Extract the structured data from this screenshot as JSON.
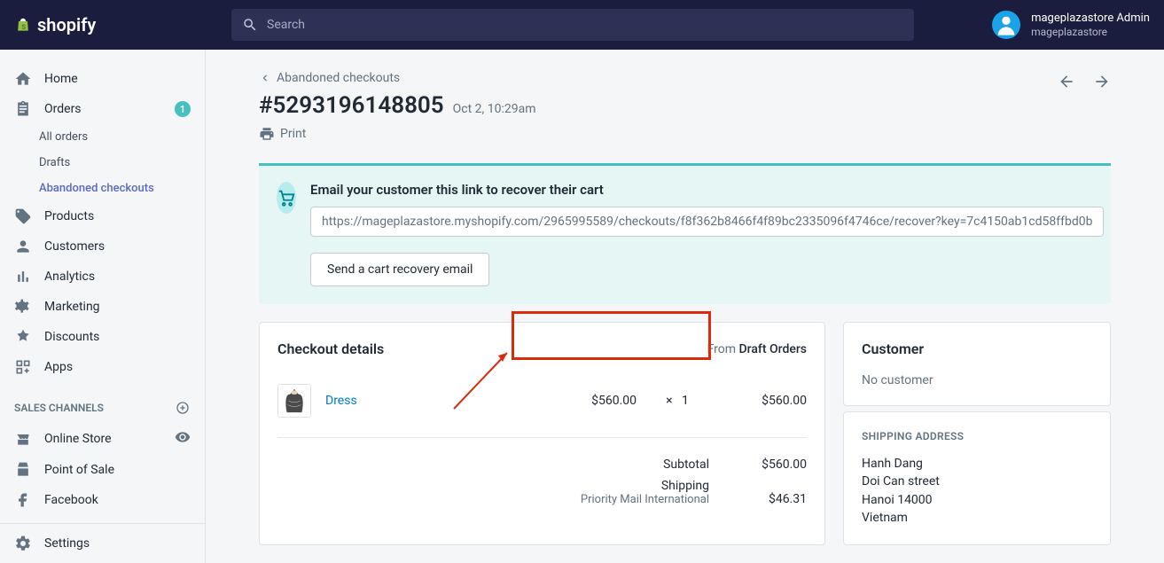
{
  "topbar": {
    "brand": "shopify",
    "search_placeholder": "Search",
    "user_name": "mageplazastore Admin",
    "store_name": "mageplazastore"
  },
  "sidebar": {
    "home": "Home",
    "orders": "Orders",
    "orders_badge": "1",
    "all_orders": "All orders",
    "drafts": "Drafts",
    "abandoned": "Abandoned checkouts",
    "products": "Products",
    "customers": "Customers",
    "analytics": "Analytics",
    "marketing": "Marketing",
    "discounts": "Discounts",
    "apps": "Apps",
    "channels_header": "SALES CHANNELS",
    "online_store": "Online Store",
    "pos": "Point of Sale",
    "facebook": "Facebook",
    "settings": "Settings"
  },
  "page": {
    "breadcrumb": "Abandoned checkouts",
    "title": "#5293196148805",
    "date": "Oct 2, 10:29am",
    "print": "Print"
  },
  "recover": {
    "title": "Email your customer this link to recover their cart",
    "url": "https://mageplazastore.myshopify.com/2965995589/checkouts/f8f362b8466f4f89bc2335096f4746ce/recover?key=7c4150ab1cd58ffbd0b",
    "button": "Send a cart recovery email"
  },
  "details": {
    "heading": "Checkout details",
    "from_label": "From ",
    "from_value": "Draft Orders",
    "item_name": "Dress",
    "item_price": "$560.00",
    "qty_sep": "×",
    "item_qty": "1",
    "item_total": "$560.00",
    "subtotal_label": "Subtotal",
    "subtotal_value": "$560.00",
    "shipping_label": "Shipping",
    "shipping_method": "Priority Mail International",
    "shipping_value": "$46.31"
  },
  "customer": {
    "heading": "Customer",
    "empty": "No customer",
    "addr_heading": "SHIPPING ADDRESS",
    "name": "Hanh Dang",
    "street": "Doi Can street",
    "city": "Hanoi 14000",
    "country": "Vietnam"
  }
}
